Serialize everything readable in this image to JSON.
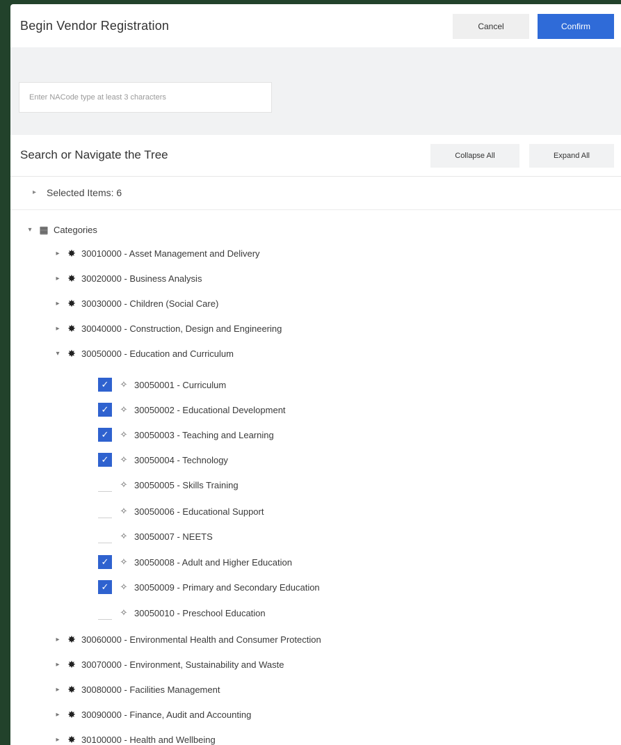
{
  "header": {
    "title": "Begin Vendor Registration",
    "cancel_label": "Cancel",
    "confirm_label": "Confirm"
  },
  "search": {
    "placeholder": "Enter NACode type at least 3 characters"
  },
  "toolbar": {
    "title": "Search or Navigate the Tree",
    "collapse_label": "Collapse All",
    "expand_label": "Expand All"
  },
  "selected": {
    "label": "Selected Items: 6"
  },
  "tree": {
    "root_label": "Categories",
    "categories": [
      {
        "label": "30010000 - Asset Management and Delivery",
        "expanded": false
      },
      {
        "label": "30020000 - Business Analysis",
        "expanded": false
      },
      {
        "label": "30030000 - Children (Social Care)",
        "expanded": false
      },
      {
        "label": "30040000 - Construction, Design and Engineering",
        "expanded": false
      },
      {
        "label": "30050000 - Education and Curriculum",
        "expanded": true
      },
      {
        "label": "30060000 - Environmental Health and Consumer Protection",
        "expanded": false
      },
      {
        "label": "30070000 - Environment, Sustainability and Waste",
        "expanded": false
      },
      {
        "label": "30080000 - Facilities Management",
        "expanded": false
      },
      {
        "label": "30090000 - Finance, Audit and Accounting",
        "expanded": false
      },
      {
        "label": "30100000 - Health and Wellbeing",
        "expanded": false
      }
    ],
    "children": [
      {
        "label": "30050001 - Curriculum",
        "checked": true
      },
      {
        "label": "30050002 - Educational Development",
        "checked": true
      },
      {
        "label": "30050003 - Teaching and Learning",
        "checked": true
      },
      {
        "label": "30050004 - Technology",
        "checked": true
      },
      {
        "label": "30050005 - Skills Training",
        "checked": false
      },
      {
        "label": "30050006 - Educational Support",
        "checked": false
      },
      {
        "label": "30050007 - NEETS",
        "checked": false
      },
      {
        "label": "30050008 - Adult and Higher Education",
        "checked": true
      },
      {
        "label": "30050009 - Primary and Secondary Education",
        "checked": true
      },
      {
        "label": "30050010 - Preschool Education",
        "checked": false
      }
    ]
  },
  "colors": {
    "accent": "#2f6bd8",
    "checkbox": "#2f62cf",
    "background": "#22422b"
  }
}
